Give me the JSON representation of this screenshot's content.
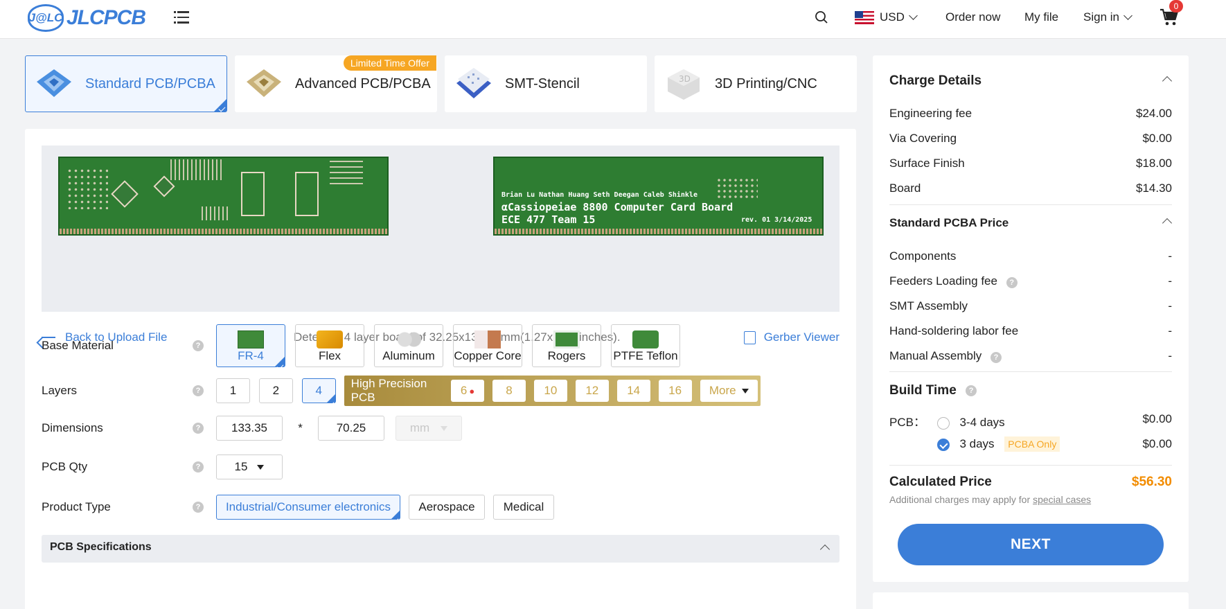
{
  "header": {
    "logo_mark": "J@LC",
    "logo_text": "JLCPCB",
    "currency": "USD",
    "order_now": "Order now",
    "my_file": "My file",
    "sign_in": "Sign in",
    "cart_count": "0"
  },
  "tabs": [
    {
      "label": "Standard PCB/PCBA",
      "active": true
    },
    {
      "label": "Advanced PCB/PCBA",
      "badge": "Limited Time Offer"
    },
    {
      "label": "SMT-Stencil"
    },
    {
      "label": "3D Printing/CNC"
    }
  ],
  "preview": {
    "back_label": "Back to Upload File",
    "detected": "Detected 4 layer board of 32.25x133.35mm(1.27x5.25 inches).",
    "gerber_viewer": "Gerber Viewer",
    "board_names": "Brian Lu Nathan Huang Seth Deegan Caleb Shinkle",
    "board_title": "αCassiopeiae 8800 Computer Card Board",
    "board_team": "ECE 477 Team 15",
    "board_rev": "rev. 01 3/14/2025"
  },
  "form": {
    "base_material": {
      "label": "Base Material",
      "options": [
        "FR-4",
        "Flex",
        "Aluminum",
        "Copper Core",
        "Rogers",
        "PTFE Teflon"
      ],
      "selected": "FR-4"
    },
    "layers": {
      "label": "Layers",
      "options": [
        "1",
        "2",
        "4"
      ],
      "selected": "4",
      "high_precision_label": "High Precision PCB",
      "high_precision_options": [
        "6",
        "8",
        "10",
        "12",
        "14",
        "16"
      ],
      "more": "More"
    },
    "dimensions": {
      "label": "Dimensions",
      "length": "133.35",
      "times": "*",
      "width": "70.25",
      "unit": "mm"
    },
    "pcb_qty": {
      "label": "PCB Qty",
      "value": "15"
    },
    "product_type": {
      "label": "Product Type",
      "options": [
        "Industrial/Consumer electronics",
        "Aerospace",
        "Medical"
      ],
      "selected": "Industrial/Consumer electronics"
    },
    "specs_header": "PCB Specifications"
  },
  "charge": {
    "title": "Charge Details",
    "items": [
      {
        "label": "Engineering fee",
        "value": "$24.00"
      },
      {
        "label": "Via Covering",
        "value": "$0.00"
      },
      {
        "label": "Surface Finish",
        "value": "$18.00"
      },
      {
        "label": "Board",
        "value": "$14.30"
      }
    ],
    "pcba_title": "Standard PCBA Price",
    "pcba_items": [
      {
        "label": "Components",
        "value": "-"
      },
      {
        "label": "Feeders Loading fee",
        "value": "-"
      },
      {
        "label": "SMT Assembly",
        "value": "-"
      },
      {
        "label": "Hand-soldering labor fee",
        "value": "-"
      },
      {
        "label": "Manual Assembly",
        "value": "-"
      }
    ],
    "build_time_title": "Build Time",
    "build_pcb_label": "PCB：",
    "build_options": [
      {
        "label": "3-4 days",
        "value": "$0.00",
        "selected": false
      },
      {
        "label": "3 days",
        "value": "$0.00",
        "selected": true,
        "tag": "PCBA Only"
      }
    ],
    "calculated_label": "Calculated Price",
    "calculated_value": "$56.30",
    "note_prefix": "Additional charges may apply for",
    "note_link": "special cases",
    "next": "NEXT"
  },
  "colors": {
    "accent": "#3b7ed8",
    "price": "#f28c00",
    "gold": "#c9a64b"
  }
}
